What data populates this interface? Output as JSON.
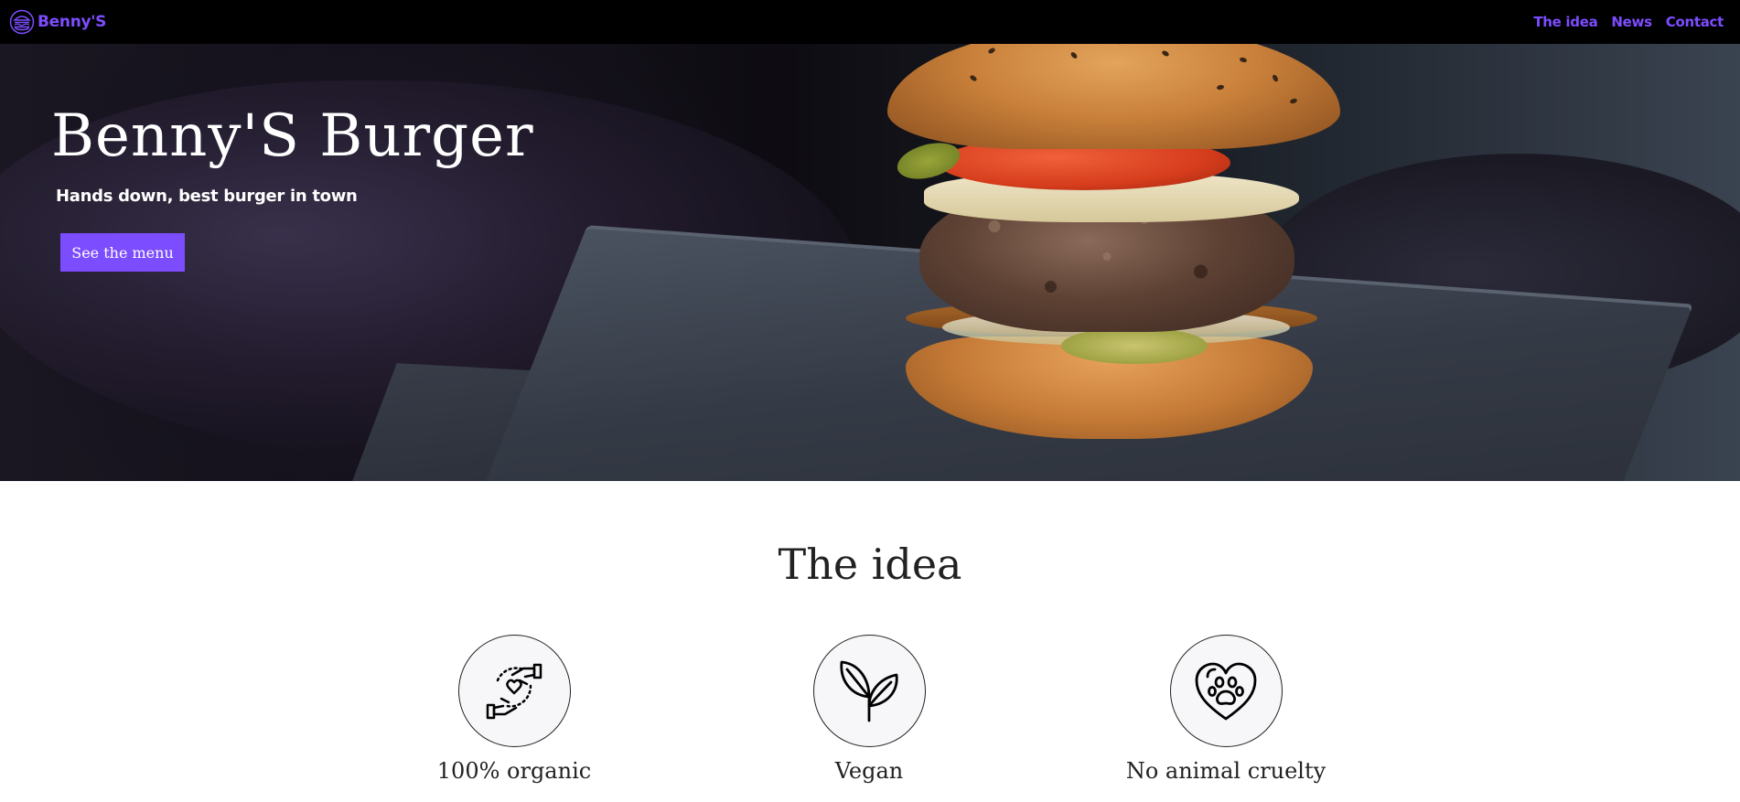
{
  "navbar": {
    "brand_name": "Benny'S",
    "brand_icon": "burger-icon",
    "links": [
      "The idea",
      "News",
      "Contact"
    ],
    "link_color": "#7c4dff",
    "background": "#000000"
  },
  "hero": {
    "title": "Benny'S Burger",
    "subtitle": "Hands down, best burger in town",
    "button_label": "See the menu",
    "button_color": "#7c4dff"
  },
  "idea": {
    "title": "The idea",
    "features": [
      {
        "icon": "hands-heart-icon",
        "label": "100% organic"
      },
      {
        "icon": "sprout-icon",
        "label": "Vegan"
      },
      {
        "icon": "heart-paw-icon",
        "label": "No animal cruelty"
      }
    ]
  }
}
